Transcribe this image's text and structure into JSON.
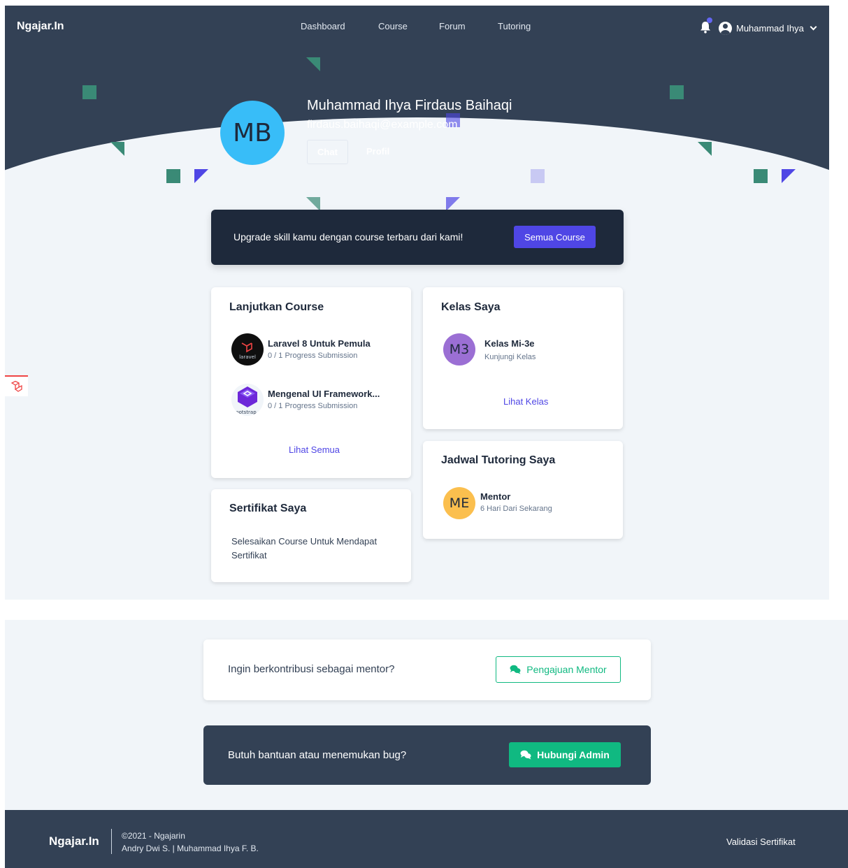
{
  "navbar": {
    "brand": "Ngajar.In",
    "links": [
      "Dashboard",
      "Course",
      "Forum",
      "Tutoring"
    ],
    "user_name": "Muhammad Ihya"
  },
  "profile": {
    "initials": "MB",
    "name": "Muhammad Ihya Firdaus Baihaqi",
    "email": "firdaus.baihaqi@example.com",
    "chat_label": "Chat",
    "profil_label": "Profil"
  },
  "upgrade": {
    "text": "Upgrade skill kamu dengan course terbaru dari kami!",
    "button": "Semua Course"
  },
  "lanjutkan_course": {
    "title": "Lanjutkan Course",
    "items": [
      {
        "title": "Laravel 8 Untuk Pemula",
        "progress": "0 / 1 Progress Submission",
        "logo_text": "laravel"
      },
      {
        "title": "Mengenal UI Framework...",
        "progress": "0 / 1 Progress Submission",
        "logo_text": "ootstrap"
      }
    ],
    "link": "Lihat Semua"
  },
  "kelas_saya": {
    "title": "Kelas Saya",
    "items": [
      {
        "initials": "M3",
        "title": "Kelas Mi-3e",
        "sub": "Kunjungi Kelas"
      }
    ],
    "link": "Lihat Kelas"
  },
  "sertifikat": {
    "title": "Sertifikat Saya",
    "text_line1": "Selesaikan Course Untuk Mendapat",
    "text_line2": "Sertifikat"
  },
  "jadwal": {
    "title": "Jadwal Tutoring Saya",
    "items": [
      {
        "initials": "ME",
        "title": "Mentor",
        "sub": "6 Hari Dari Sekarang"
      }
    ]
  },
  "mentor_cta": {
    "text": "Ingin berkontribusi sebagai mentor?",
    "button": "Pengajuan Mentor"
  },
  "help_cta": {
    "text": "Butuh bantuan atau menemukan bug?",
    "button": "Hubungi Admin"
  },
  "footer": {
    "brand": "Ngajar.In",
    "copy_line1": "©2021 - Ngajarin",
    "copy_line2": "Andry Dwi S. | Muhammad Ihya F. B.",
    "validasi": "Validasi Sertifikat"
  },
  "colors": {
    "hero": "#334155",
    "accent": "#4f46e5",
    "success": "#10b981",
    "avatar_profile": "#38bdf8",
    "avatar_kelas": "#9b6fd4",
    "avatar_mentor": "#fbbf4e"
  },
  "icons": [
    "bell-icon",
    "user-circle-icon",
    "chevron-down-icon",
    "comments-icon",
    "laravel-logo-icon",
    "bootstrap-logo-icon"
  ]
}
